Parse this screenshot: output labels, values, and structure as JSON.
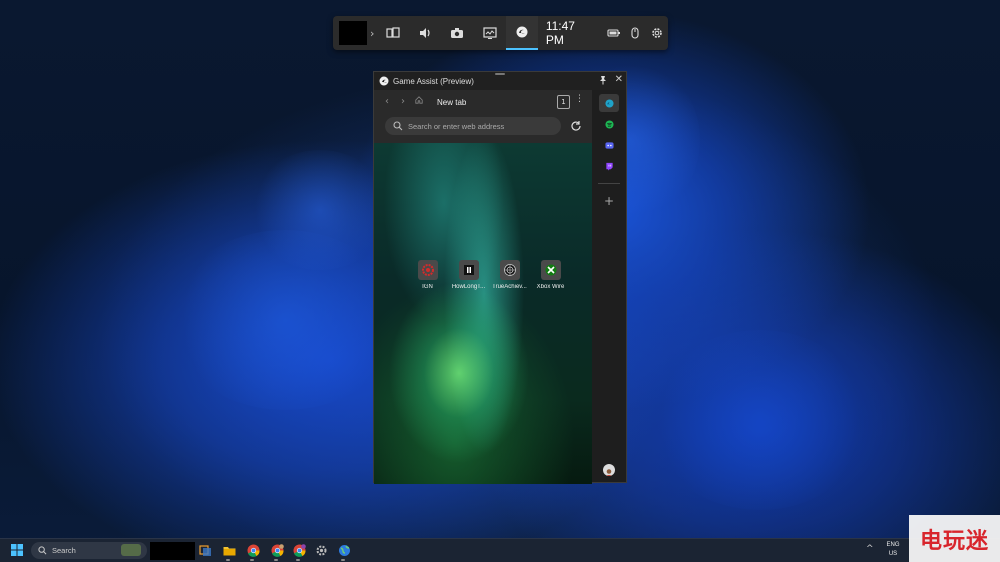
{
  "gamebar": {
    "time": "11:47 PM",
    "widgets": [
      "widget-menu-icon",
      "audio-icon",
      "capture-icon",
      "performance-icon",
      "game-assist-icon"
    ],
    "status_icons": [
      "battery-icon",
      "mouse-icon",
      "settings-icon"
    ],
    "accent": "#4cc2ff"
  },
  "assist": {
    "title": "Game Assist (Preview)",
    "tab_title": "New tab",
    "tab_count": "1",
    "address_placeholder": "Search or enter web address",
    "shortcuts": [
      {
        "label": "IGN",
        "icon": "ign-icon"
      },
      {
        "label": "HowLongT...",
        "icon": "howlongtobeat-icon"
      },
      {
        "label": "TrueAchiev...",
        "icon": "trueachievements-icon"
      },
      {
        "label": "Xbox Wire",
        "icon": "xbox-icon"
      }
    ],
    "sidebar_apps": [
      "edge-icon",
      "spotify-icon",
      "discord-icon",
      "twitch-icon"
    ],
    "add_label": "+"
  },
  "taskbar": {
    "search_label": "Search",
    "lang_line1": "ENG",
    "lang_line2": "US",
    "chevron": "^"
  },
  "watermark": {
    "text": "电玩迷"
  }
}
